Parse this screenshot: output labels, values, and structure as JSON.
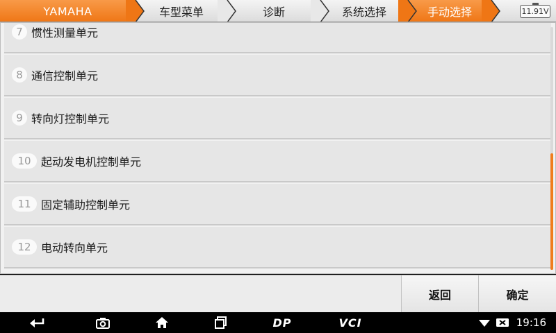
{
  "breadcrumb": {
    "brand": "YAMAHA",
    "items": [
      "车型菜单",
      "诊断",
      "系统选择",
      "手动选择"
    ],
    "battery": "11.91V"
  },
  "list": {
    "items": [
      {
        "num": "7",
        "label": "惯性测量单元"
      },
      {
        "num": "8",
        "label": "通信控制单元"
      },
      {
        "num": "9",
        "label": "转向灯控制单元"
      },
      {
        "num": "10",
        "label": "起动发电机控制单元"
      },
      {
        "num": "11",
        "label": "固定辅助控制单元"
      },
      {
        "num": "12",
        "label": "电动转向单元"
      }
    ]
  },
  "actions": {
    "back": "返回",
    "confirm": "确定"
  },
  "navbar": {
    "dp": "DP",
    "vci": "VCI",
    "time": "19:16"
  },
  "colors": {
    "accent": "#f07d1c",
    "list_bg": "#e6e6e6"
  }
}
